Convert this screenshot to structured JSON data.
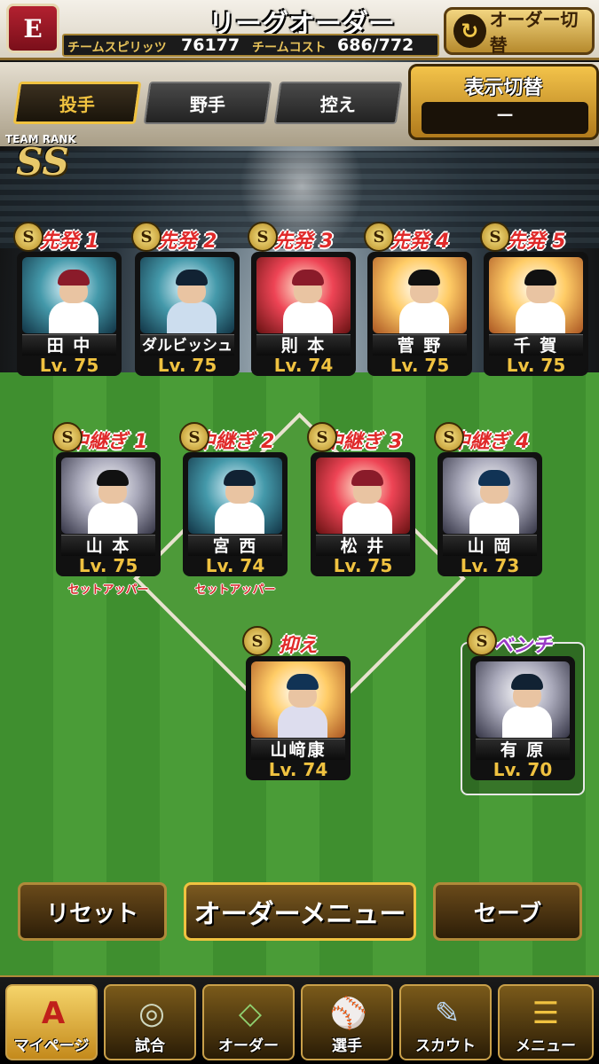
{
  "header": {
    "team_logo_text": "E",
    "title": "リーグオーダー",
    "spirit_label": "チームスピリッツ",
    "spirit_value": "76177",
    "cost_label": "チームコスト",
    "cost_value": "686/772",
    "switch_order_label": "オーダー切替"
  },
  "tabs": [
    {
      "label": "投手",
      "active": true
    },
    {
      "label": "野手",
      "active": false
    },
    {
      "label": "控え",
      "active": false
    }
  ],
  "display_toggle": {
    "title": "表示切替",
    "value": "－"
  },
  "team_rank": {
    "label": "TEAM RANK",
    "value": "SS"
  },
  "starters": [
    {
      "role": "先発 1",
      "name": "田 中",
      "level": "Lv. 75"
    },
    {
      "role": "先発 2",
      "name": "ダルビッシュ",
      "level": "Lv. 75"
    },
    {
      "role": "先発 3",
      "name": "則 本",
      "level": "Lv. 74"
    },
    {
      "role": "先発 4",
      "name": "菅 野",
      "level": "Lv. 75"
    },
    {
      "role": "先発 5",
      "name": "千 賀",
      "level": "Lv. 75"
    }
  ],
  "relievers": [
    {
      "role": "中継ぎ 1",
      "name": "山 本",
      "level": "Lv. 75",
      "sub_role": "セットアッパー"
    },
    {
      "role": "中継ぎ 2",
      "name": "宮 西",
      "level": "Lv. 74",
      "sub_role": "セットアッパー"
    },
    {
      "role": "中継ぎ 3",
      "name": "松 井",
      "level": "Lv. 75",
      "sub_role": ""
    },
    {
      "role": "中継ぎ 4",
      "name": "山 岡",
      "level": "Lv. 73",
      "sub_role": ""
    }
  ],
  "closer": {
    "role": "抑え",
    "name": "山﨑康",
    "level": "Lv. 74"
  },
  "bench": {
    "role": "ベンチ",
    "name": "有 原",
    "level": "Lv. 70"
  },
  "badge_letter": "S",
  "actions": {
    "reset": "リセット",
    "order_menu": "オーダーメニュー",
    "save": "セーブ"
  },
  "nav": [
    {
      "label": "マイページ",
      "icon": "A",
      "icon_name": "mypage-icon"
    },
    {
      "label": "試合",
      "icon": "◎",
      "icon_name": "stadium-icon"
    },
    {
      "label": "オーダー",
      "icon": "◇",
      "icon_name": "field-icon"
    },
    {
      "label": "選手",
      "icon": "⚾",
      "icon_name": "player-icon"
    },
    {
      "label": "スカウト",
      "icon": "✎",
      "icon_name": "scout-icon"
    },
    {
      "label": "メニュー",
      "icon": "☰",
      "icon_name": "menu-icon"
    }
  ],
  "colors": {
    "accent_gold": "#f0c240",
    "role_red": "#e02a2a",
    "bench_purple": "#9a3ac6"
  }
}
